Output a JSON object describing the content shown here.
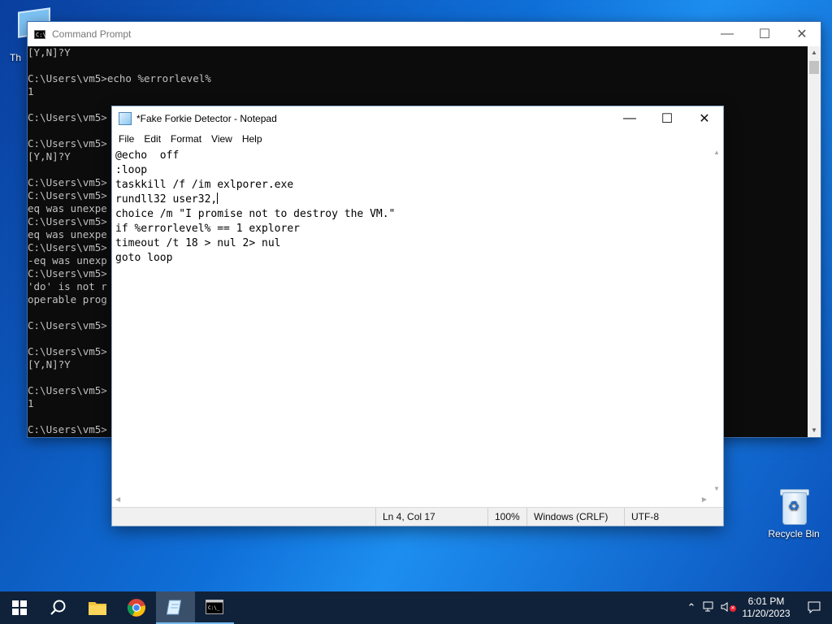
{
  "desktop": {
    "recycle_bin_label": "Recycle Bin",
    "this_pc_label": "Th"
  },
  "cmd": {
    "title": "Command Prompt",
    "lines": [
      "[Y,N]?Y",
      "",
      "C:\\Users\\vm5>echo %errorlevel%",
      "1",
      "",
      "C:\\Users\\vm5>",
      "",
      "C:\\Users\\vm5>",
      "[Y,N]?Y",
      "",
      "C:\\Users\\vm5>",
      "C:\\Users\\vm5>",
      "eq was unexpe",
      "C:\\Users\\vm5>",
      "eq was unexpe",
      "C:\\Users\\vm5>",
      "-eq was unexp",
      "C:\\Users\\vm5>",
      "'do' is not r",
      "operable prog",
      "",
      "C:\\Users\\vm5>",
      "",
      "C:\\Users\\vm5>",
      "[Y,N]?Y",
      "",
      "C:\\Users\\vm5>",
      "1",
      "",
      "C:\\Users\\vm5>"
    ]
  },
  "notepad": {
    "title": "*Fake Forkie Detector - Notepad",
    "menu": [
      "File",
      "Edit",
      "Format",
      "View",
      "Help"
    ],
    "lines": [
      "@echo  off",
      ":loop",
      "taskkill /f /im exlporer.exe",
      "rundll32 user32,",
      "choice /m \"I promise not to destroy the VM.\"",
      "if %errorlevel% == 1 explorer",
      "timeout /t 18 > nul 2> nul",
      "goto loop"
    ],
    "status": {
      "position": "Ln 4, Col 17",
      "zoom": "100%",
      "line_ending": "Windows (CRLF)",
      "encoding": "UTF-8"
    }
  },
  "taskbar": {
    "time": "6:01 PM",
    "date": "11/20/2023"
  }
}
